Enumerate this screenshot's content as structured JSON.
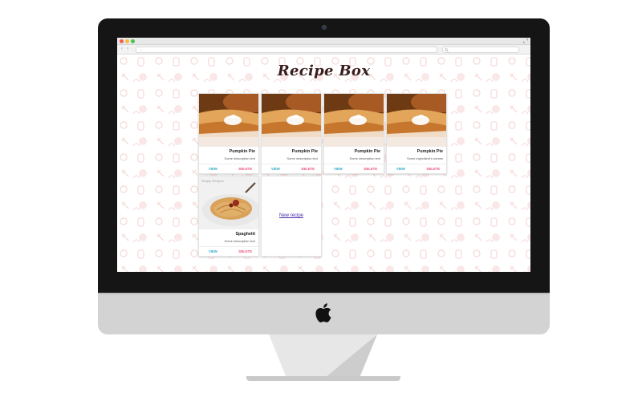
{
  "browser": {
    "url_value": "←",
    "nav_back": "‹",
    "nav_forward": "›"
  },
  "app": {
    "title": "Recipe Box",
    "accent_view": "#2aa7c9",
    "accent_delete": "#ee4e7a"
  },
  "recipes": [
    {
      "name": "Pumpkin Pie",
      "description": "Some description text",
      "view_label": "VIEW",
      "delete_label": "DELETE",
      "image": "pumpkin-pie-photo"
    },
    {
      "name": "Pumpkin Pie",
      "description": "Some description text",
      "view_label": "VIEW",
      "delete_label": "DELETE",
      "image": "pumpkin-pie-photo"
    },
    {
      "name": "Pumpkin Pie",
      "description": "Some description text",
      "view_label": "VIEW",
      "delete_label": "DELETE",
      "image": "pumpkin-pie-photo"
    },
    {
      "name": "Pumpkin Pie",
      "description": "Some ingredient's names",
      "view_label": "VIEW",
      "delete_label": "DELETE",
      "image": "pumpkin-pie-photo"
    },
    {
      "name": "Spaghetti",
      "description": "Some description text",
      "view_label": "VIEW",
      "delete_label": "DELETE",
      "image": "spaghetti-photo",
      "watermark": "Simply Recipes"
    }
  ],
  "new_recipe": {
    "label": "New recipe"
  }
}
